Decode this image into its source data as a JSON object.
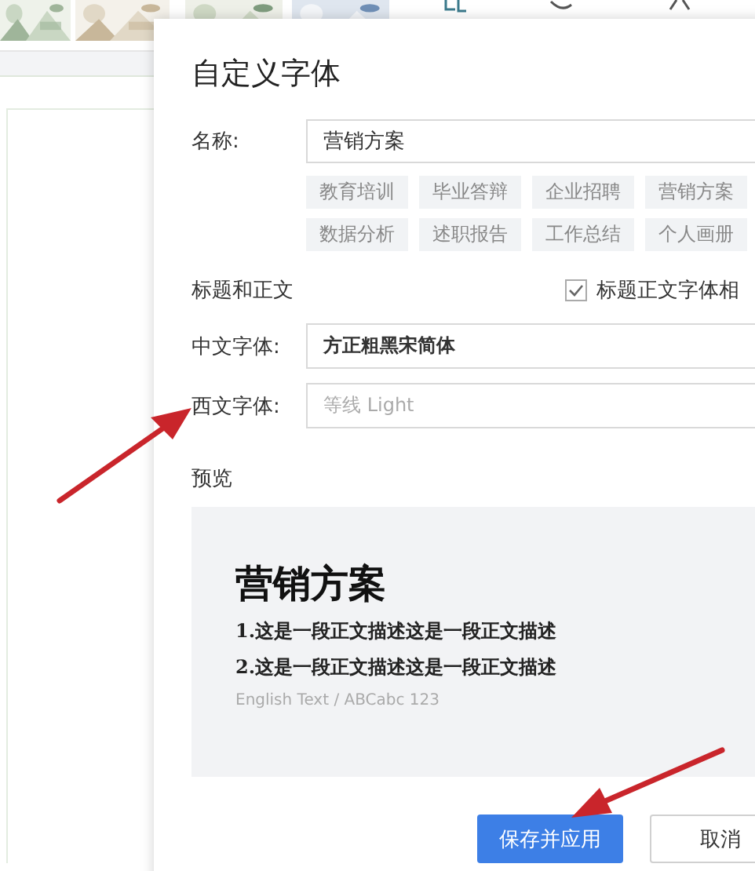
{
  "dialog": {
    "title": "自定义字体",
    "name_field": {
      "label": "名称:",
      "value": "营销方案"
    },
    "tags": [
      {
        "label": "教育培训"
      },
      {
        "label": "毕业答辩"
      },
      {
        "label": "企业招聘"
      },
      {
        "label": "营销方案"
      },
      {
        "label": "数据分析"
      },
      {
        "label": "述职报告"
      },
      {
        "label": "工作总结"
      },
      {
        "label": "个人画册"
      }
    ],
    "section_title": "标题和正文",
    "same_font_checkbox": {
      "label": "标题正文字体相",
      "checked": true
    },
    "font_rows": [
      {
        "label": "中文字体:",
        "value": "方正粗黑宋简体",
        "disabled": false
      },
      {
        "label": "西文字体:",
        "value": "等线 Light",
        "disabled": true
      }
    ],
    "preview_label": "预览",
    "preview": {
      "heading": "营销方案",
      "lines": [
        "1.这是一段正文描述这是一段正文描述",
        "2.这是一段正文描述这是一段正文描述"
      ],
      "english": "English Text / ABCabc 123"
    },
    "buttons": [
      {
        "label": "保存并应用",
        "kind": "primary"
      },
      {
        "label": "取消",
        "kind": "secondary"
      }
    ]
  },
  "annotations": [
    {
      "kind": "arrow"
    },
    {
      "kind": "arrow"
    }
  ]
}
